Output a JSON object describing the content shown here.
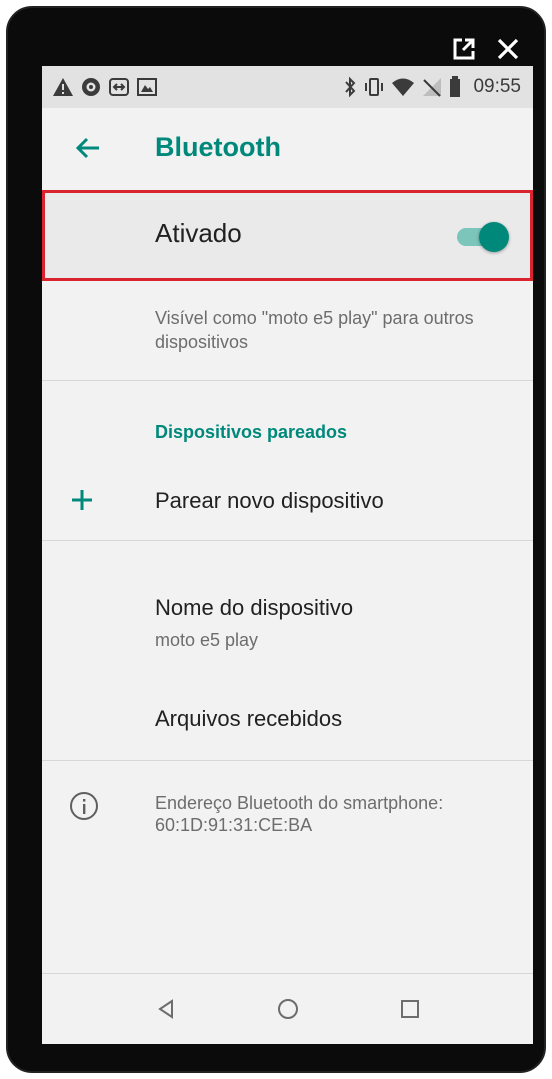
{
  "status_bar": {
    "time": "09:55",
    "left_icons": [
      "warning-icon",
      "eye-icon",
      "cast-icon",
      "gallery-icon"
    ],
    "right_icons": [
      "bluetooth-icon",
      "vibrate-icon",
      "wifi-icon",
      "no-signal-icon",
      "battery-icon"
    ]
  },
  "top_controls": [
    "external-link-icon",
    "close-icon"
  ],
  "app_bar": {
    "title": "Bluetooth",
    "back_icon": "arrow-left-icon"
  },
  "bluetooth_toggle": {
    "label": "Ativado",
    "state": "on",
    "highlight_color": "#d9232e"
  },
  "visible_as": {
    "text": "Visível como \"moto e5 play\" para outros dispositivos"
  },
  "paired_devices": {
    "section_title": "Dispositivos pareados",
    "pair_new_label": "Parear novo dispositivo"
  },
  "device_name": {
    "title": "Nome do dispositivo",
    "value": "moto e5 play"
  },
  "received_files": {
    "label": "Arquivos recebidos"
  },
  "address": {
    "line1": "Endereço Bluetooth do smartphone:",
    "line2": "60:1D:91:31:CE:BA"
  },
  "nav_bar": [
    "back-triangle-icon",
    "home-circle-icon",
    "recents-square-icon"
  ],
  "colors": {
    "accent": "#00897b",
    "toggle_track": "#7bc5bb",
    "background": "#f2f2f2",
    "frame": "#0b0b0b"
  }
}
